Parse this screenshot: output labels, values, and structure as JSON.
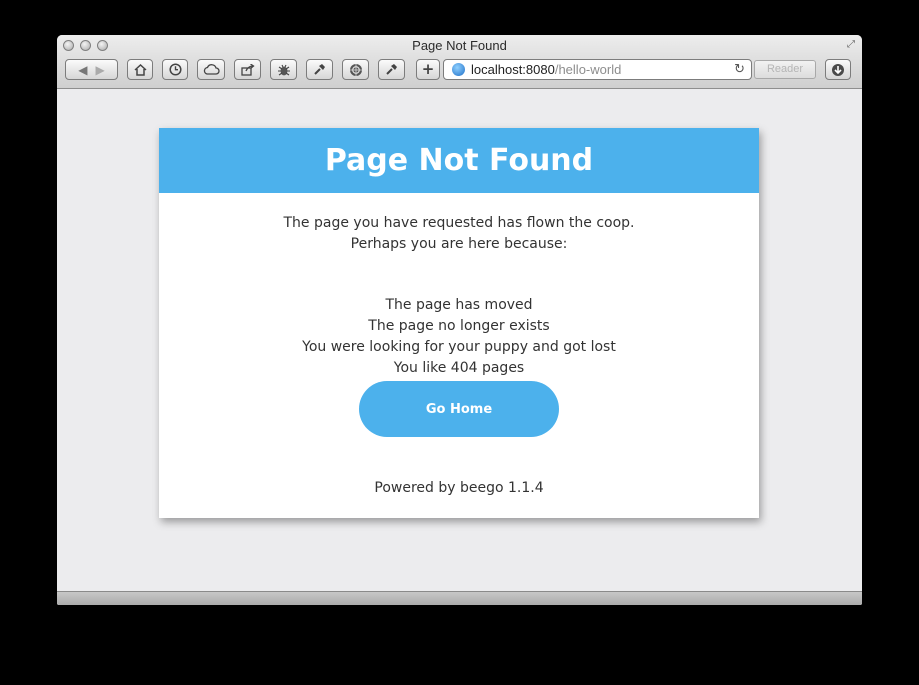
{
  "window": {
    "title": "Page Not Found",
    "address": {
      "host": "localhost:8080",
      "path": "/hello-world"
    },
    "reader_label": "Reader",
    "toolbar_icons": [
      "back-icon",
      "forward-icon",
      "home-icon",
      "history-icon",
      "icloud-icon",
      "share-icon",
      "bug-icon",
      "develop-icon",
      "web-inspector-icon",
      "settings-icon",
      "add-icon"
    ]
  },
  "page": {
    "heading": "Page Not Found",
    "intro_line1": "The page you have requested has flown the coop.",
    "intro_line2": "Perhaps you are here because:",
    "reasons": [
      "The page has moved",
      "The page no longer exists",
      "You were looking for your puppy and got lost",
      "You like 404 pages"
    ],
    "button_label": "Go Home",
    "footer": "Powered by beego 1.1.4"
  },
  "colors": {
    "accent": "#4cb1ec",
    "background": "#ececee",
    "card": "#ffffff"
  }
}
